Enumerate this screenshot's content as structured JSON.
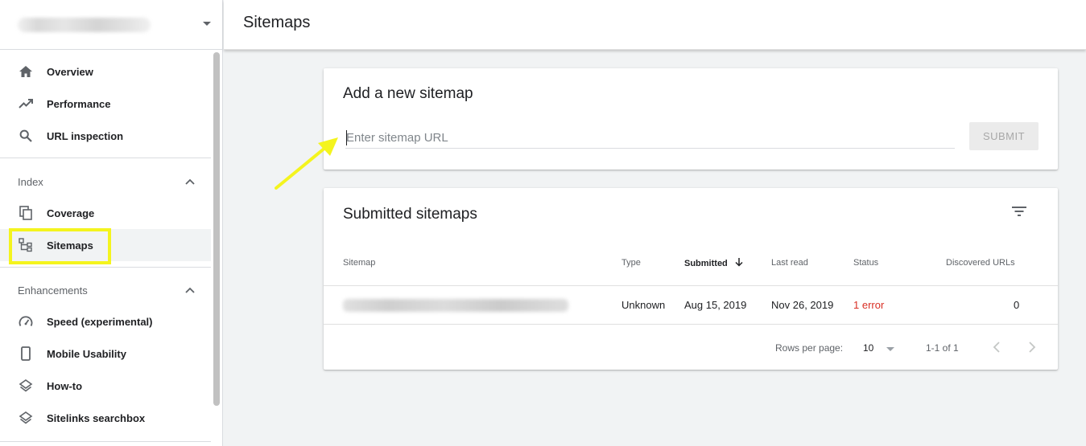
{
  "sidebar": {
    "nav_top": [
      {
        "label": "Overview",
        "icon": "home-icon"
      },
      {
        "label": "Performance",
        "icon": "trending-up-icon"
      },
      {
        "label": "URL inspection",
        "icon": "search-icon"
      }
    ],
    "index_section": {
      "title": "Index",
      "items": [
        {
          "label": "Coverage",
          "icon": "copy-icon"
        },
        {
          "label": "Sitemaps",
          "icon": "sitemap-icon"
        }
      ]
    },
    "enhancements_section": {
      "title": "Enhancements",
      "items": [
        {
          "label": "Speed (experimental)",
          "icon": "speedometer-icon"
        },
        {
          "label": "Mobile Usability",
          "icon": "smartphone-icon"
        },
        {
          "label": "How-to",
          "icon": "layers-icon"
        },
        {
          "label": "Sitelinks searchbox",
          "icon": "layers-icon"
        }
      ]
    }
  },
  "header": {
    "title": "Sitemaps"
  },
  "add_card": {
    "title": "Add a new sitemap",
    "input_placeholder": "Enter sitemap URL",
    "submit_label": "SUBMIT"
  },
  "submitted_card": {
    "title": "Submitted sitemaps",
    "columns": [
      "Sitemap",
      "Type",
      "Submitted",
      "Last read",
      "Status",
      "Discovered URLs"
    ],
    "rows": [
      {
        "type": "Unknown",
        "submitted": "Aug 15, 2019",
        "last_read": "Nov 26, 2019",
        "status": "1 error",
        "discovered": "0"
      }
    ],
    "footer": {
      "rows_per_page_label": "Rows per page:",
      "rows_per_page": "10",
      "range": "1-1 of 1"
    }
  },
  "colors": {
    "highlight": "#f4f41e",
    "error": "#d93025"
  }
}
